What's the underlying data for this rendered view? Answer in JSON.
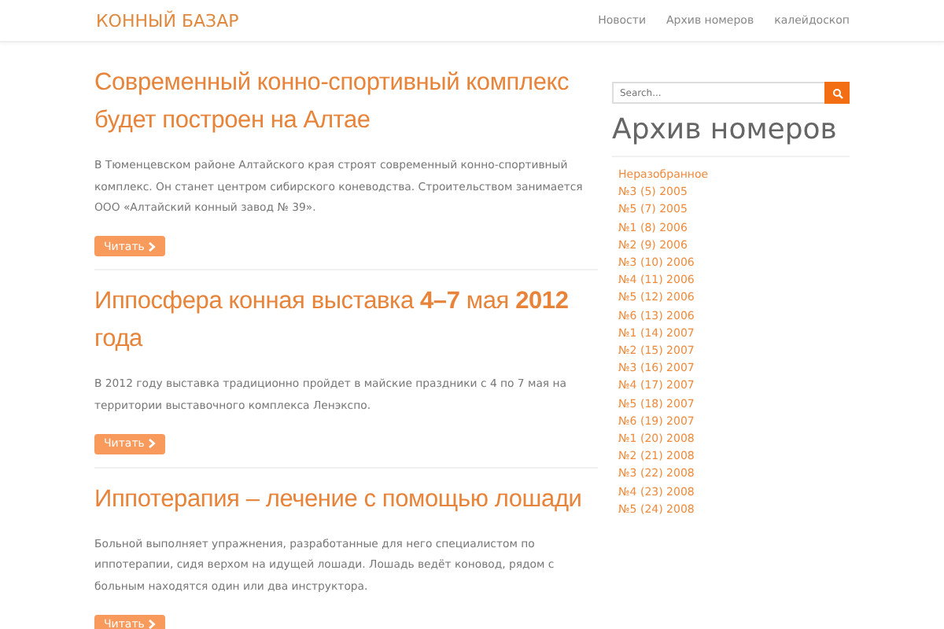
{
  "navbar": {
    "brand": "КОННЫЙ БАЗАР",
    "links": [
      "Новости",
      "Архив номеров",
      "калейдоскоп"
    ]
  },
  "posts": [
    {
      "title": "Современный конно-спортивный комплекс будет построен на Алтае",
      "excerpt": "В Тюменцевском районе Алтайского края строят современный конно-спортивный комплекс. Он станет центром сибирского коневодства. Строительством занимается ООО «Алтайский конный завод № 39».",
      "button": "Читать"
    },
    {
      "title": "Иппосфера конная выставка **4–7** мая **2012** года",
      "excerpt": "В 2012 году выставка традиционно пройдет в майские праздники с 4 по 7 мая на территории выставочного комплекса Ленэкспо.",
      "button": "Читать"
    },
    {
      "title": "Иппотерапия – лечение с помощью лошади",
      "excerpt": "Больной выполняет упражнения, разработанные для него специалистом по иппотерапии, сидя верхом на идущей лошади. Лошадь ведёт коновод, рядом с больным находятся один или два инструктора.",
      "button": "Читать"
    }
  ],
  "sidebar": {
    "search": {
      "placeholder": "Search..."
    },
    "heading": "Архив номеров",
    "items": [
      "Неразобранное",
      "№3 (5) 2005",
      "№5 (7) 2005",
      "№1 (8) 2006",
      "№2 (9) 2006",
      "№3 (10) 2006",
      "№4 (11) 2006",
      "№5 (12) 2006",
      "№6 (13) 2006",
      "№1 (14) 2007",
      "№2 (15) 2007",
      "№3 (16) 2007",
      "№4 (17) 2007",
      "№5 (18) 2007",
      "№6 (19) 2007",
      "№1 (20) 2008",
      "№2 (21) 2008",
      "№3 (22) 2008",
      "№4 (23) 2008",
      "№5 (24) 2008"
    ]
  }
}
